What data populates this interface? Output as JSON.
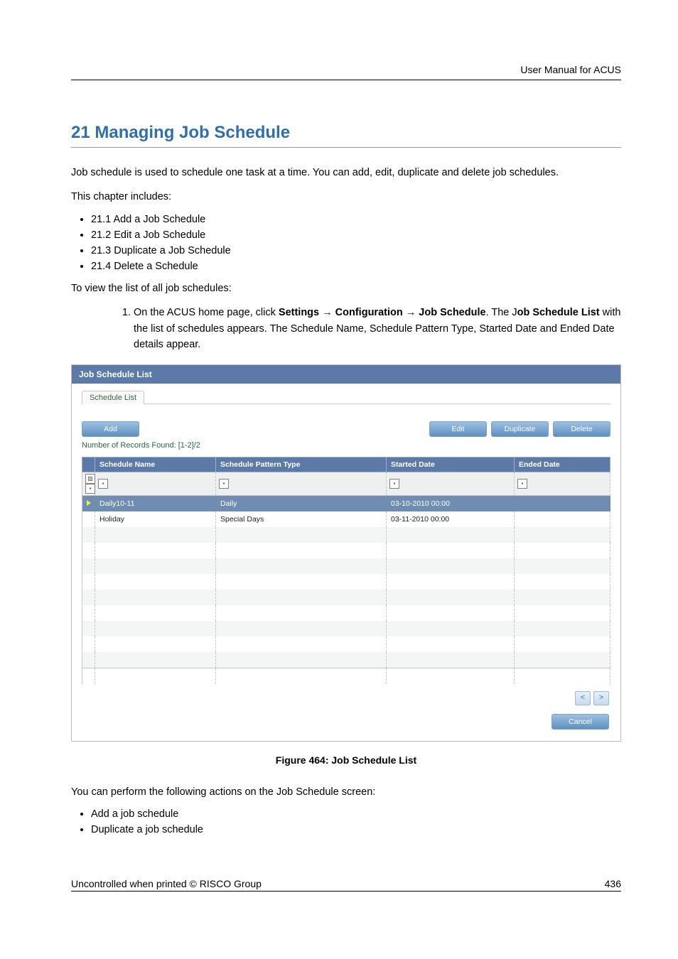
{
  "header": {
    "doc_title": "User Manual for ACUS"
  },
  "section": {
    "title": "21 Managing Job Schedule",
    "intro": "Job schedule is used to schedule one task at a time. You can add, edit, duplicate and delete job schedules.",
    "includes_label": "This chapter includes:",
    "includes": [
      "21.1 Add a Job Schedule",
      "21.2 Edit a Job Schedule",
      "21.3 Duplicate a Job Schedule",
      "21.4 Delete a Schedule"
    ],
    "view_intro": "To view the list of all job schedules:",
    "step1_pre": "On the ACUS home page, click ",
    "step1_bold1": "Settings",
    "step1_arrow": " → ",
    "step1_bold2": "Configuration",
    "step1_bold3": "Job Schedule",
    "step1_mid": ". The J",
    "step1_bold4": "ob Schedule List",
    "step1_post": " with the list of schedules appears. The Schedule Name, Schedule Pattern Type, Started Date and Ended Date details appear."
  },
  "panel": {
    "title": "Job Schedule List",
    "tab": "Schedule List",
    "buttons": {
      "add": "Add",
      "edit": "Edit",
      "duplicate": "Duplicate",
      "delete": "Delete",
      "cancel": "Cancel"
    },
    "records_found": "Number of Records Found: [1-2]/2",
    "columns": {
      "name": "Schedule Name",
      "pattern": "Schedule Pattern Type",
      "started": "Started Date",
      "ended": "Ended Date"
    },
    "rows": [
      {
        "name": "Daily10-11",
        "pattern": "Daily",
        "started": "03-10-2010 00:00",
        "ended": ""
      },
      {
        "name": "Holiday",
        "pattern": "Special Days",
        "started": "03-11-2010 00:00",
        "ended": ""
      }
    ]
  },
  "figure_caption": "Figure 464: Job Schedule List",
  "post_panel": {
    "intro": "You can perform the following actions on the Job Schedule screen:",
    "items": [
      "Add a job schedule",
      "Duplicate a job schedule"
    ]
  },
  "footer": {
    "left": "Uncontrolled when printed © RISCO Group",
    "page": "436"
  },
  "chart_data": null
}
